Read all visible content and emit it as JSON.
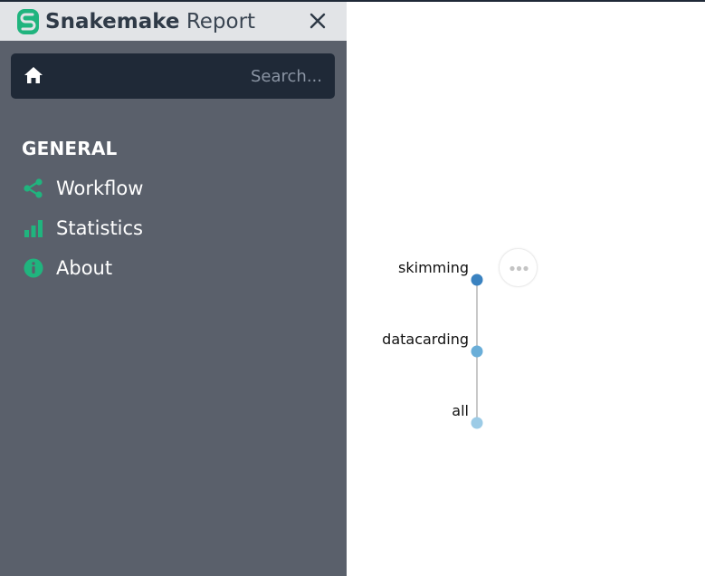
{
  "header": {
    "title_bold": "Snakemake",
    "title_light": " Report",
    "logo_icon": "snake-logo-icon",
    "close_icon": "close-icon"
  },
  "search": {
    "placeholder": "Search...",
    "value": "",
    "home_icon": "home-icon"
  },
  "sidebar": {
    "section": "GENERAL",
    "items": [
      {
        "label": "Workflow",
        "icon": "share-icon"
      },
      {
        "label": "Statistics",
        "icon": "bar-chart-icon"
      },
      {
        "label": "About",
        "icon": "info-icon"
      }
    ]
  },
  "colors": {
    "accent": "#20b47e",
    "sidebar_bg": "#5a606b",
    "header_bg": "#e2e4e7",
    "search_bg": "#1f2937",
    "node_dark": "#3a82c0",
    "node_mid": "#6aaed8",
    "node_light": "#9ccbe6",
    "edge": "#c8c8c8"
  },
  "dag": {
    "nodes": [
      {
        "name": "skimming",
        "color": "#3a82c0"
      },
      {
        "name": "datacarding",
        "color": "#6aaed8"
      },
      {
        "name": "all",
        "color": "#9ccbe6"
      }
    ],
    "edges": [
      [
        "skimming",
        "datacarding"
      ],
      [
        "datacarding",
        "all"
      ]
    ],
    "more_icon": "ellipsis-icon"
  }
}
